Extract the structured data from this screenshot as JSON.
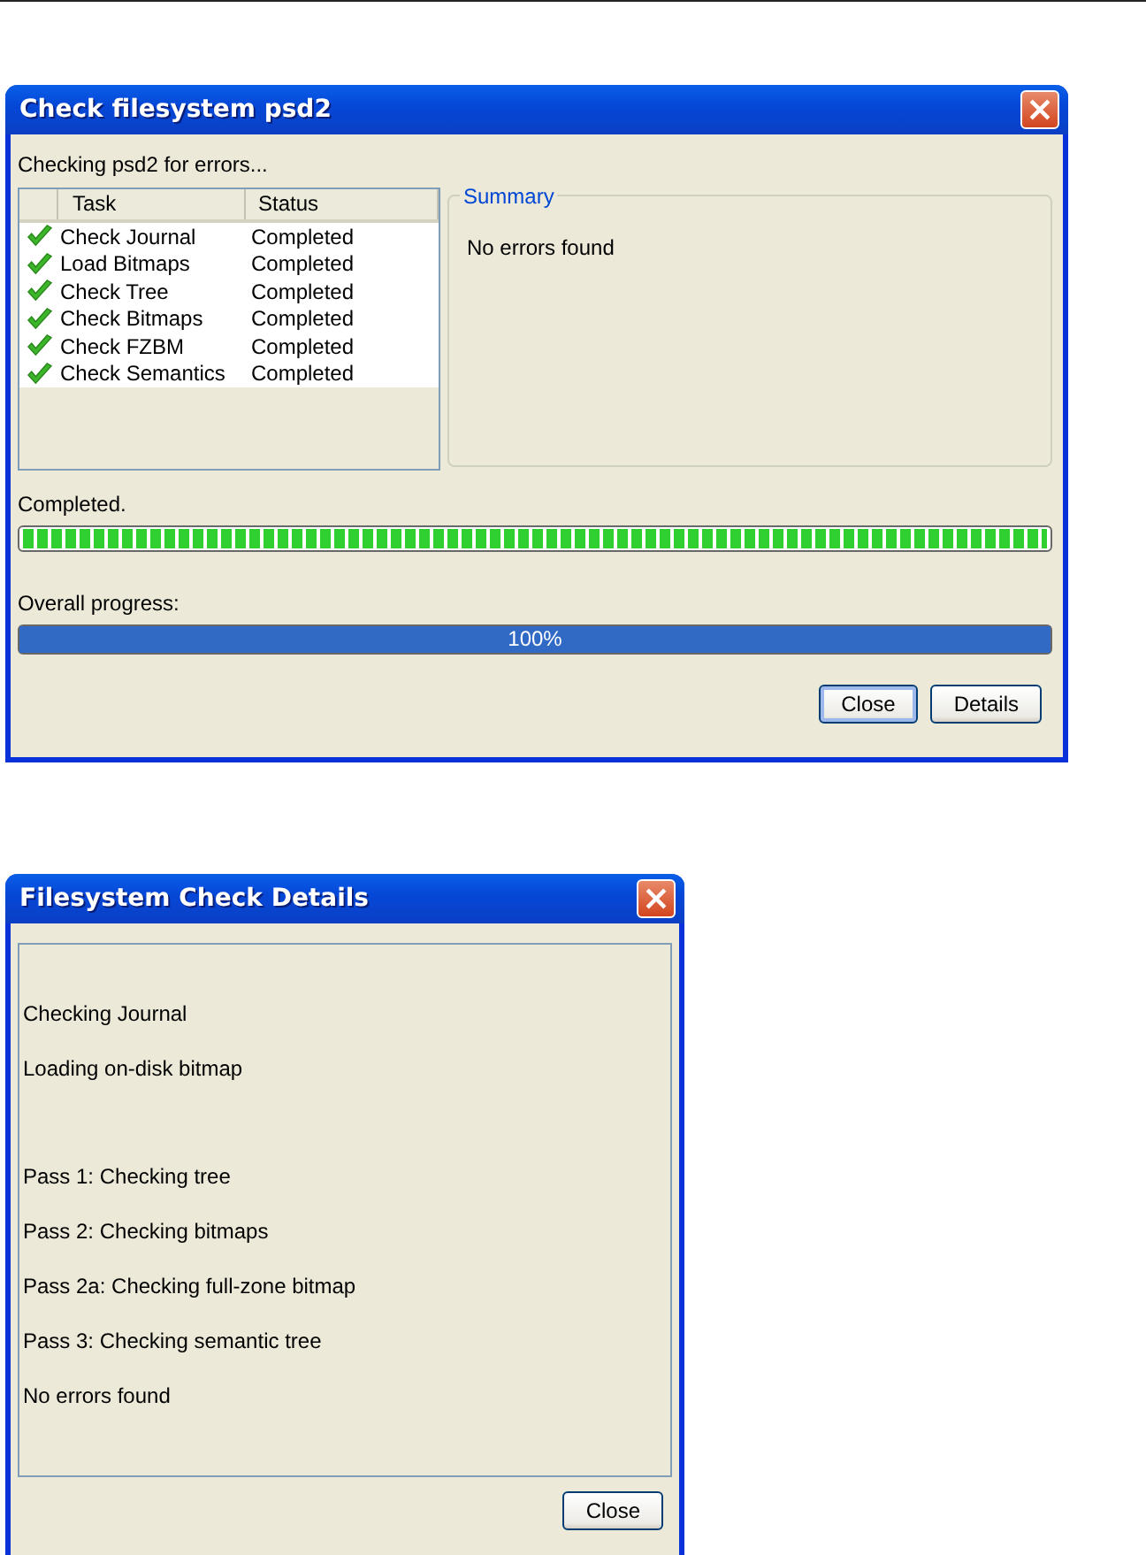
{
  "check_dialog": {
    "title": "Check filesystem psd2",
    "heading": "Checking psd2 for errors...",
    "task_table": {
      "columns": [
        "Task",
        "Status"
      ],
      "rows": [
        {
          "task": "Check Journal",
          "status": "Completed",
          "done": true
        },
        {
          "task": "Load Bitmaps",
          "status": "Completed",
          "done": true
        },
        {
          "task": "Check Tree",
          "status": "Completed",
          "done": true
        },
        {
          "task": "Check Bitmaps",
          "status": "Completed",
          "done": true
        },
        {
          "task": "Check FZBM",
          "status": "Completed",
          "done": true
        },
        {
          "task": "Check Semantics",
          "status": "Completed",
          "done": true
        }
      ]
    },
    "summary": {
      "title": "Summary",
      "text": "No errors found"
    },
    "step_progress": {
      "label": "Completed.",
      "level": 1
    },
    "overall_progress": {
      "label": "Overall progress:",
      "level": 1,
      "reading": "100%"
    },
    "buttons": [
      {
        "label": "Close",
        "default": true
      },
      {
        "label": "Details",
        "default": false
      }
    ]
  },
  "details_dialog": {
    "title": "Filesystem Check Details",
    "log_groups": [
      [
        "Checking Journal",
        "Loading on-disk bitmap"
      ],
      [
        "Pass 1: Checking tree",
        "Pass 2: Checking bitmaps",
        "Pass 2a: Checking full-zone bitmap",
        "Pass 3: Checking semantic tree",
        "No errors found"
      ]
    ],
    "buttons": [
      {
        "label": "Close",
        "default": false
      }
    ]
  }
}
